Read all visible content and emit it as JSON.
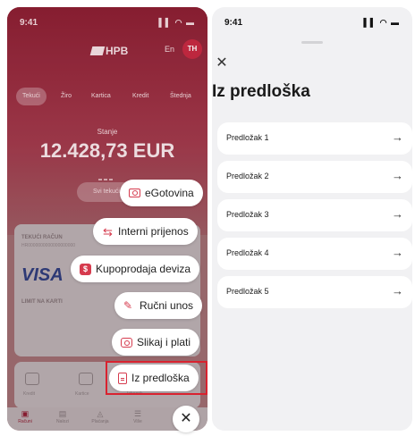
{
  "left": {
    "status": {
      "time": "9:41",
      "icons": "▌▌ ◠ ▬"
    },
    "bank_logo": "HPB",
    "lang": "En",
    "avatar": "TH",
    "tabs": [
      "Tekući",
      "Žiro",
      "Kartica",
      "Kredit",
      "Štednja"
    ],
    "balance_label": "Stanje",
    "balance": "12.428,73 EUR",
    "details_button": "Svi tekući",
    "card": {
      "title": "TEKUĆI RAČUN",
      "iban": "HR0000000000000000000",
      "brand": "VISA",
      "limit": "LIMIT NA KARTI"
    },
    "quick": [
      "Kredit",
      "Kartice",
      "Izbornik"
    ],
    "tabbar": [
      {
        "icon": "▣",
        "label": "Računi"
      },
      {
        "icon": "▤",
        "label": "Nalozi"
      },
      {
        "icon": "◬",
        "label": "Plaćanja"
      },
      {
        "icon": "☰",
        "label": "Više"
      }
    ],
    "actions": [
      {
        "label": "eGotovina",
        "icon": "cash-icon"
      },
      {
        "label": "Interni prijenos",
        "icon": "transfer-arrows-icon"
      },
      {
        "label": "Kupoprodaja deviza",
        "icon": "currency-exchange-icon"
      },
      {
        "label": "Ručni unos",
        "icon": "pencil-icon"
      },
      {
        "label": "Slikaj i plati",
        "icon": "camera-icon"
      },
      {
        "label": "Iz predloška",
        "icon": "document-icon"
      }
    ],
    "close_glyph": "✕",
    "accent": "#d63b4e"
  },
  "right": {
    "status": {
      "time": "9:41",
      "icons": "▌▌ ◠ ▬"
    },
    "close_glyph": "✕",
    "title": "Iz predloška",
    "templates": [
      "Predložak 1",
      "Predložak 2",
      "Predložak 3",
      "Predložak 4",
      "Predložak 5"
    ],
    "arrow_glyph": "→"
  }
}
